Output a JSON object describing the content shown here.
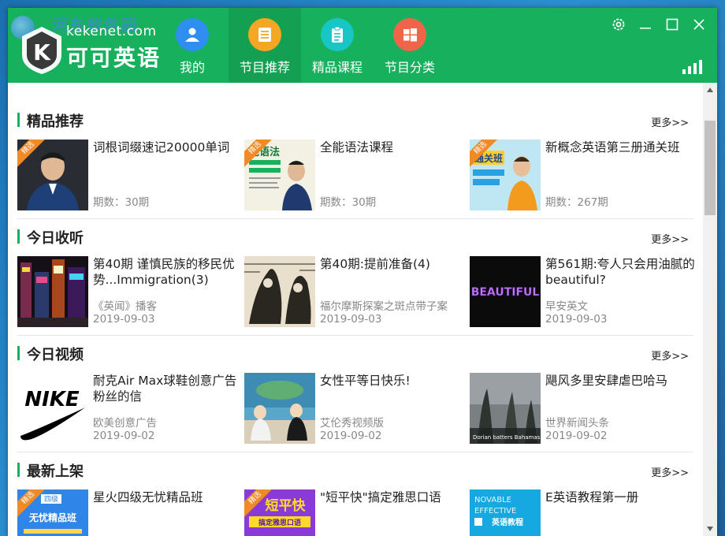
{
  "app": {
    "watermark": "河东软件园",
    "brand_url": "kekenet.com",
    "brand_name": "可可英语"
  },
  "colors": {
    "brand_green": "#17b05c",
    "nav_active": "#14a053",
    "badge_orange": "#f08a24"
  },
  "nav": [
    {
      "label": "我的",
      "icon": "user-icon",
      "color": "#2e8ff0"
    },
    {
      "label": "节目推荐",
      "icon": "list-icon",
      "color": "#f5a623",
      "active": true
    },
    {
      "label": "精品课程",
      "icon": "clipboard-icon",
      "color": "#19c6c6"
    },
    {
      "label": "节目分类",
      "icon": "windows-grid-icon",
      "color": "#f06449"
    }
  ],
  "sections": [
    {
      "title": "精品推荐",
      "more": "更多>>",
      "items": [
        {
          "title": "词根词缀速记20000单词",
          "meta1": "期数：30期",
          "meta2": "",
          "badge": "精选",
          "thumb": "teacher-portrait"
        },
        {
          "title": "全能语法课程",
          "meta1": "期数：30期",
          "meta2": "",
          "badge": "精选",
          "thumb": "grammar-poster",
          "thumb_text": "能语法"
        },
        {
          "title": "新概念英语第三册通关班",
          "meta1": "期数：267期",
          "meta2": "",
          "badge": "精选",
          "thumb": "nce-poster",
          "thumb_text": "通关班"
        }
      ]
    },
    {
      "title": "今日收听",
      "more": "更多>>",
      "items": [
        {
          "title": "第40期 谨慎民族的移民优势...Immigration(3)",
          "meta1": "《英闻》播客",
          "meta2": "2019-09-03",
          "thumb": "city-night"
        },
        {
          "title": "第40期:提前准备(4)",
          "meta1": "福尔摩斯探案之斑点带子案",
          "meta2": "2019-09-03",
          "thumb": "sketch-art"
        },
        {
          "title": "第561期:夸人只会用油腻的beautiful?",
          "meta1": "早安英文",
          "meta2": "2019-09-03",
          "thumb": "beautiful-text",
          "thumb_text": "BEAUTIFUL"
        }
      ]
    },
    {
      "title": "今日视频",
      "more": "更多>>",
      "items": [
        {
          "title": "耐克Air Max球鞋创意广告粉丝的信",
          "meta1": "欧美创意广告",
          "meta2": "2019-09-02",
          "thumb": "nike-logo",
          "thumb_text": "NIKE"
        },
        {
          "title": "女性平等日快乐!",
          "meta1": "艾伦秀视频版",
          "meta2": "2019-09-02",
          "thumb": "talk-show"
        },
        {
          "title": "飓风多里安肆虐巴哈马",
          "meta1": "世界新闻头条",
          "meta2": "2019-09-02",
          "thumb": "storm",
          "thumb_text": "Dorian batters Bahamas"
        }
      ]
    },
    {
      "title": "最新上架",
      "more": "更多>>",
      "items": [
        {
          "title": "星火四级无忧精品班",
          "meta1": "",
          "meta2": "",
          "badge": "精选",
          "thumb": "cet4-poster",
          "thumb_text": "无忧精品班",
          "thumb_tag": "四级"
        },
        {
          "title": "\"短平快\"搞定雅思口语",
          "meta1": "",
          "meta2": "",
          "badge": "精选",
          "thumb": "ielts-poster",
          "thumb_text": "短平快",
          "thumb_sub": "搞定雅思口语"
        },
        {
          "title": "E英语教程第一册",
          "meta1": "",
          "meta2": "",
          "thumb": "e-english-poster",
          "thumb_text": "NOVABLE",
          "thumb_text2": "EFFECTIVE",
          "thumb_sub": "英语教程"
        }
      ]
    }
  ]
}
